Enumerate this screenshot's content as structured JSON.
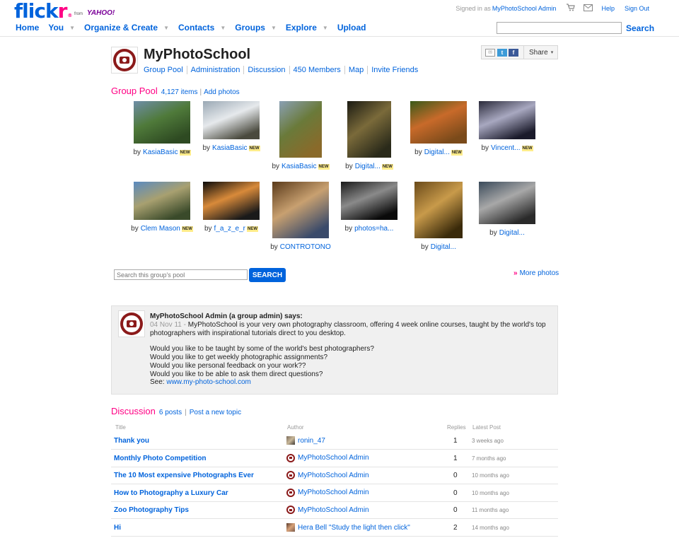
{
  "header": {
    "logo": {
      "brand_fl": "flick",
      "brand_r": "r",
      "reg": "®",
      "from": "from",
      "yahoo": "YAHOO!"
    },
    "signed_in_prefix": "Signed in as",
    "username": "MyPhotoSchool Admin",
    "cart_icon": "cart-icon",
    "mail_icon": "mail-icon",
    "help": "Help",
    "sign_out": "Sign Out",
    "nav": [
      {
        "label": "Home",
        "caret": false
      },
      {
        "label": "You",
        "caret": true
      },
      {
        "label": "Organize & Create",
        "caret": true
      },
      {
        "label": "Contacts",
        "caret": true
      },
      {
        "label": "Groups",
        "caret": true
      },
      {
        "label": "Explore",
        "caret": true
      },
      {
        "label": "Upload",
        "caret": false
      }
    ],
    "search_value": "",
    "search_button": "Search"
  },
  "group": {
    "name": "MyPhotoSchool",
    "tabs": [
      "Group Pool",
      "Administration",
      "Discussion",
      "450 Members",
      "Map",
      "Invite Friends"
    ],
    "share": {
      "label": "Share",
      "caret": "▾",
      "mail": "✉",
      "twitter": "t",
      "facebook": "f"
    }
  },
  "pool": {
    "title": "Group Pool",
    "count": "4,127 items",
    "separator": "|",
    "add": "Add photos",
    "by": "by",
    "new_badge": "NEW",
    "photos": [
      {
        "author": "KasiaBasic",
        "new": true,
        "colors": [
          "#6f8ea8",
          "#4f7a3a",
          "#2e4a22"
        ]
      },
      {
        "author": "KasiaBasic",
        "new": true,
        "colors": [
          "#9aa8b4",
          "#e6e9ec",
          "#4a4a3e"
        ]
      },
      {
        "author": "KasiaBasic",
        "new": true,
        "colors": [
          "#8aa0b4",
          "#6a7a3a",
          "#8a6a2a"
        ]
      },
      {
        "author": "Digital...",
        "new": true,
        "colors": [
          "#1a1a12",
          "#7a6a3a",
          "#2a2a1a"
        ]
      },
      {
        "author": "Digital...",
        "new": true,
        "colors": [
          "#3a5a1a",
          "#c86a2a",
          "#7a4a1a"
        ]
      },
      {
        "author": "Vincent...",
        "new": true,
        "colors": [
          "#2a2a3a",
          "#a8a8c0",
          "#1a1a2a"
        ]
      },
      {
        "author": "Clem Mason",
        "new": true,
        "colors": [
          "#5a8ac0",
          "#a8a070",
          "#3a4a2a"
        ]
      },
      {
        "author": "f_a_z_e_r",
        "new": true,
        "colors": [
          "#0a0a0a",
          "#d88a3a",
          "#1a1a1a"
        ]
      },
      {
        "author": "CONTROTONO",
        "new": false,
        "colors": [
          "#5a3a1a",
          "#c8a070",
          "#3a4a6a"
        ]
      },
      {
        "author": "photos=ha...",
        "new": false,
        "colors": [
          "#1a1a1a",
          "#8a8a8a",
          "#0a0a0a"
        ]
      },
      {
        "author": "Digital...",
        "new": false,
        "colors": [
          "#6a4a1a",
          "#c89a4a",
          "#3a2a0a"
        ]
      },
      {
        "author": "Digital...",
        "new": false,
        "colors": [
          "#3a4a5a",
          "#a8a8a8",
          "#2a2a2a"
        ]
      }
    ],
    "search_placeholder": "Search this group's pool",
    "search_button": "SEARCH",
    "more": "More photos",
    "more_arrow": "»"
  },
  "admin_note": {
    "says": "MyPhotoSchool Admin (a group admin) says:",
    "date": "04 Nov 11 -",
    "lines": [
      "MyPhotoSchool is your very own photography classroom, offering 4 week online courses, taught by the world's top",
      "photographers with inspirational tutorials direct to you desktop."
    ],
    "questions": [
      "Would you like to be taught by some of the world's best photographers?",
      "Would you like to get weekly photographic assignments?",
      "Would you like personal feedback on your work??",
      "Would you like to be able to ask them direct questions?"
    ],
    "see_label": "See:",
    "see_link": "www.my-photo-school.com"
  },
  "discussion": {
    "title": "Discussion",
    "count": "6 posts",
    "separator": "|",
    "new_topic": "Post a new topic",
    "columns": {
      "title": "Title",
      "author": "Author",
      "replies": "Replies",
      "latest": "Latest Post"
    },
    "rows": [
      {
        "title": "Thank you",
        "author": "ronin_47",
        "avatar": "photo1",
        "replies": "1",
        "latest": "3 weeks ago"
      },
      {
        "title": "Monthly Photo Competition",
        "author": "MyPhotoSchool Admin",
        "avatar": "cam",
        "replies": "1",
        "latest": "7 months ago"
      },
      {
        "title": "The 10 Most expensive Photographs Ever",
        "author": "MyPhotoSchool Admin",
        "avatar": "cam",
        "replies": "0",
        "latest": "10 months ago"
      },
      {
        "title": "How to Photography a Luxury Car",
        "author": "MyPhotoSchool Admin",
        "avatar": "cam",
        "replies": "0",
        "latest": "10 months ago"
      },
      {
        "title": "Zoo Photography Tips",
        "author": "MyPhotoSchool Admin",
        "avatar": "cam",
        "replies": "0",
        "latest": "11 months ago"
      },
      {
        "title": "Hi",
        "author": "Hera Bell \"Study the light then click\"",
        "avatar": "photo2",
        "replies": "2",
        "latest": "14 months ago"
      }
    ]
  }
}
